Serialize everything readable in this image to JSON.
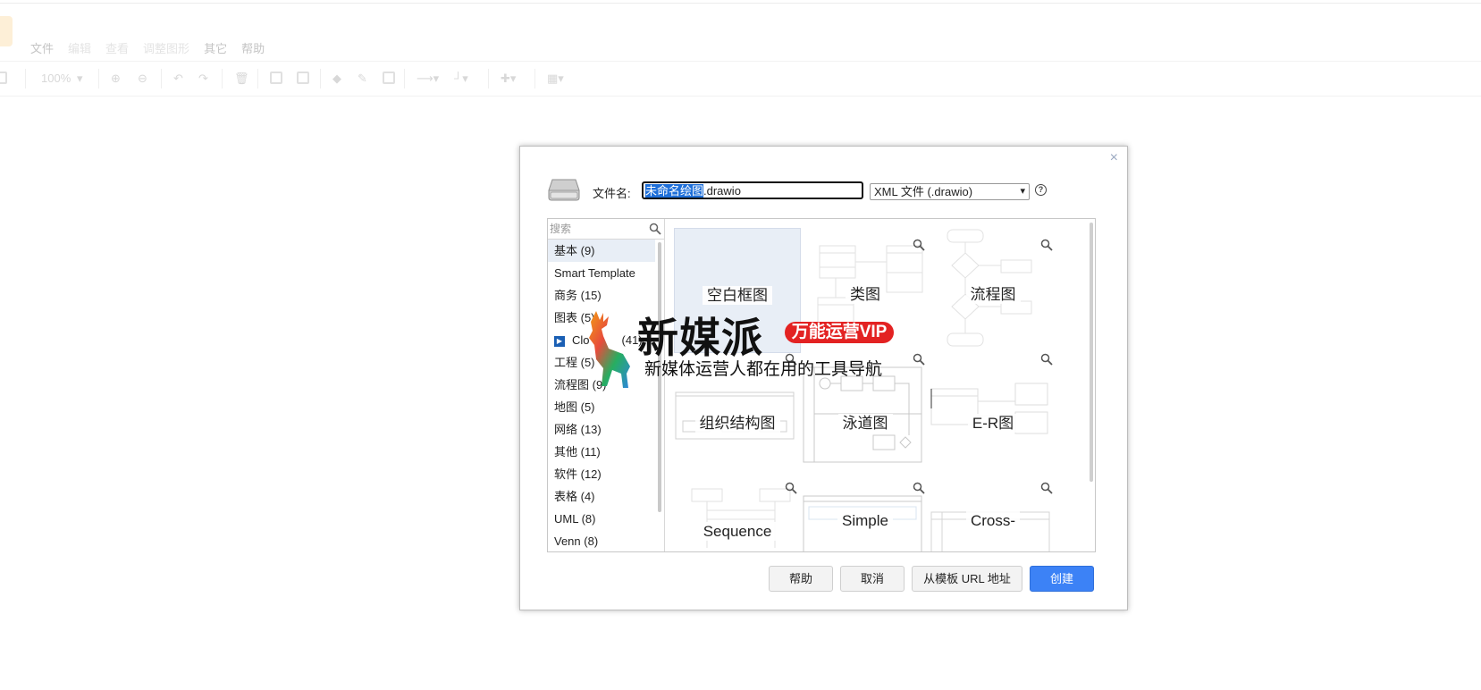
{
  "menu": [
    "文件",
    "编辑",
    "查看",
    "调整图形",
    "其它",
    "帮助"
  ],
  "toolbar": {
    "zoom": "100%"
  },
  "dialog": {
    "close": "×",
    "filename_label": "文件名:",
    "filename_selected": "未命名绘图",
    "filename_rest": ".drawio",
    "format": "XML 文件 (.drawio)",
    "help_glyph": "?",
    "search_placeholder": "搜索",
    "categories": [
      {
        "label": "基本 (9)"
      },
      {
        "label": "Smart Template"
      },
      {
        "label": "商务 (15)"
      },
      {
        "label": "图表 (5)"
      },
      {
        "label": "Clo",
        "suffix": "(41)"
      },
      {
        "label": "工程 (5)"
      },
      {
        "label": "流程图 (9)"
      },
      {
        "label": "地图 (5)"
      },
      {
        "label": "网络 (13)"
      },
      {
        "label": "其他 (11)"
      },
      {
        "label": "软件 (12)"
      },
      {
        "label": "表格 (4)"
      },
      {
        "label": "UML (8)"
      },
      {
        "label": "Venn (8)"
      }
    ],
    "templates": [
      {
        "label": "空白框图"
      },
      {
        "label": "类图"
      },
      {
        "label": "流程图"
      },
      {
        "label": "组织结构图"
      },
      {
        "label": "泳道图"
      },
      {
        "label": "E-R图"
      },
      {
        "label": "Sequence"
      },
      {
        "label": "Simple"
      },
      {
        "label": "Cross-"
      }
    ],
    "buttons": {
      "help": "帮助",
      "cancel": "取消",
      "from_url": "从模板 URL 地址",
      "create": "创建"
    }
  },
  "watermark": {
    "title": "新媒派",
    "badge": "万能运营VIP",
    "subtitle": "新媒体运营人都在用的工具导航"
  }
}
